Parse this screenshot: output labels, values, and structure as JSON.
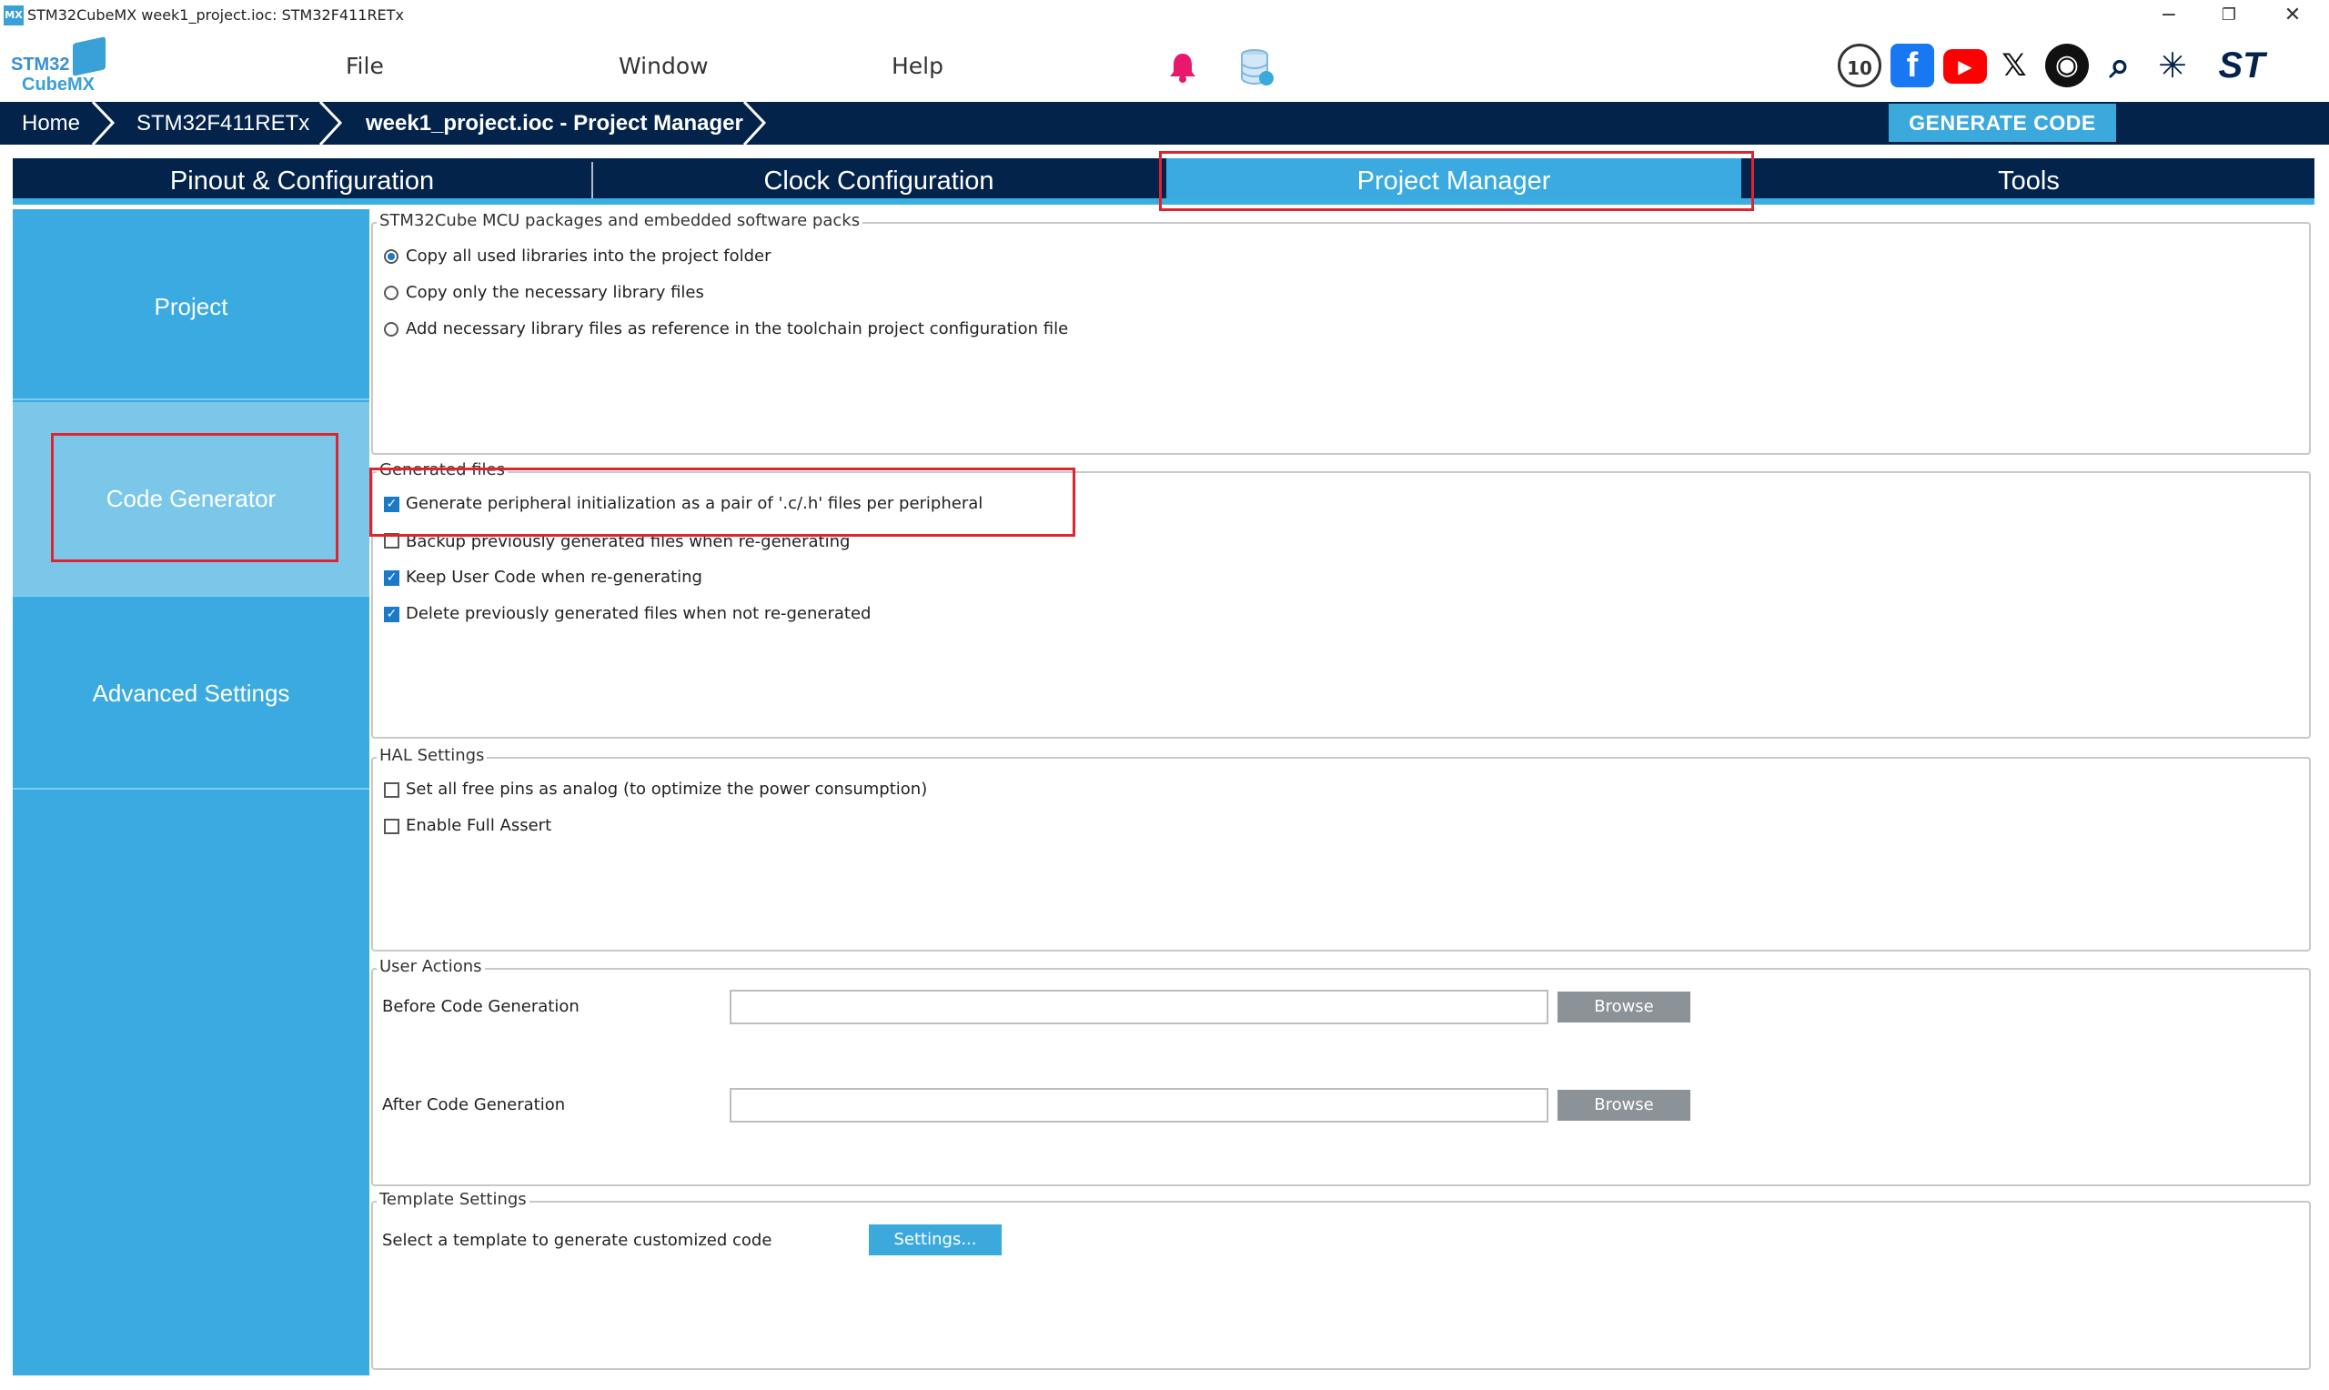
{
  "window": {
    "app_icon_text": "MX",
    "title": "STM32CubeMX week1_project.ioc: STM32F411RETx",
    "min": "−",
    "restore": "❐",
    "close": "✕"
  },
  "logo": {
    "line1": "STM32",
    "line2": "CubeMX"
  },
  "menu": {
    "file": "File",
    "window": "Window",
    "help": "Help"
  },
  "social": {
    "anniv": "10",
    "facebook": "f",
    "youtube": "▶",
    "x": "𝕏",
    "github": "◉",
    "search": "⌕",
    "network": "✳",
    "st": "ST"
  },
  "breadcrumb": {
    "home": "Home",
    "mcu": "STM32F411RETx",
    "project": "week1_project.ioc - Project Manager",
    "generate": "GENERATE CODE"
  },
  "tabs": {
    "pinout": "Pinout & Configuration",
    "clock": "Clock Configuration",
    "project_manager": "Project Manager",
    "tools": "Tools"
  },
  "nav": {
    "project": "Project",
    "code_generator": "Code Generator",
    "advanced": "Advanced Settings"
  },
  "mcu_packages": {
    "legend": "STM32Cube MCU packages and embedded software packs",
    "opt1": "Copy all used libraries into the project folder",
    "opt2": "Copy only the necessary library files",
    "opt3": "Add necessary library files as reference in the toolchain project configuration file",
    "selected": 1
  },
  "generated_files": {
    "legend": "Generated files",
    "opt1": "Generate peripheral initialization as a pair of '.c/.h' files per peripheral",
    "opt2": "Backup previously generated files when re-generating",
    "opt3": "Keep User Code when re-generating",
    "opt4": "Delete previously generated files when not re-generated"
  },
  "hal": {
    "legend": "HAL Settings",
    "opt1": "Set all free pins as analog (to optimize the power consumption)",
    "opt2": "Enable Full Assert"
  },
  "user_actions": {
    "legend": "User Actions",
    "before_label": "Before Code Generation",
    "before_value": "",
    "after_label": "After Code Generation",
    "after_value": "",
    "browse": "Browse"
  },
  "template": {
    "legend": "Template Settings",
    "label": "Select a template to generate customized code",
    "button": "Settings..."
  },
  "colors": {
    "navy": "#03234b",
    "accent": "#3ca9dd",
    "highlight": "#e0242f"
  }
}
